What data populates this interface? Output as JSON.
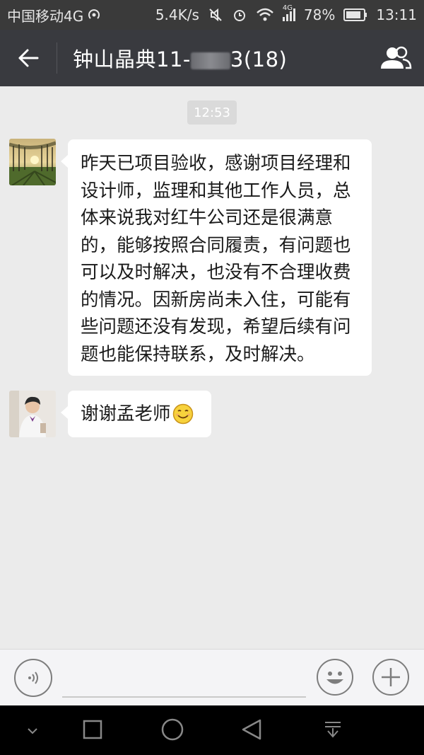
{
  "status_bar": {
    "carrier": "中国移动4G",
    "speed": "5.4K/s",
    "network": "4G",
    "battery": "78%",
    "time": "13:11"
  },
  "header": {
    "title": "钟山晶典11-",
    "title_suffix": "3(18)",
    "back_icon": "arrow-left-icon",
    "group_icon": "group-members-icon"
  },
  "chat": {
    "timestamp": "12:53",
    "messages": [
      {
        "avatar": "trees-sunset-avatar",
        "lines": [
          "昨天已项目验收，感谢项目经理和",
          "设计师，监理和其他工作人员，总",
          "体来说我对红牛公司还是很满意",
          "的，能够按照合同履责，有问题也",
          "可以及时解决，也没有不合理收费",
          "的情况。因新房尚未入住，可能有",
          "些问题还没有发现，希望后续有问",
          "题也能保持联系，及时解决。"
        ]
      },
      {
        "avatar": "person-avatar",
        "text": "谢谢孟老师",
        "emoji": "smile-emoji"
      }
    ]
  },
  "input_bar": {
    "voice_icon": "voice-input-icon",
    "emoji_icon": "emoji-icon",
    "plus_icon": "plus-icon"
  },
  "nav_bar": {
    "icons": [
      "collapse-icon",
      "recents-icon",
      "home-icon",
      "back-icon",
      "notifications-pulldown-icon"
    ]
  },
  "colors": {
    "header_bg": "#393a3f",
    "status_bg": "#3a3a3a",
    "chat_bg": "#ebebeb",
    "bubble_bg": "#ffffff"
  }
}
